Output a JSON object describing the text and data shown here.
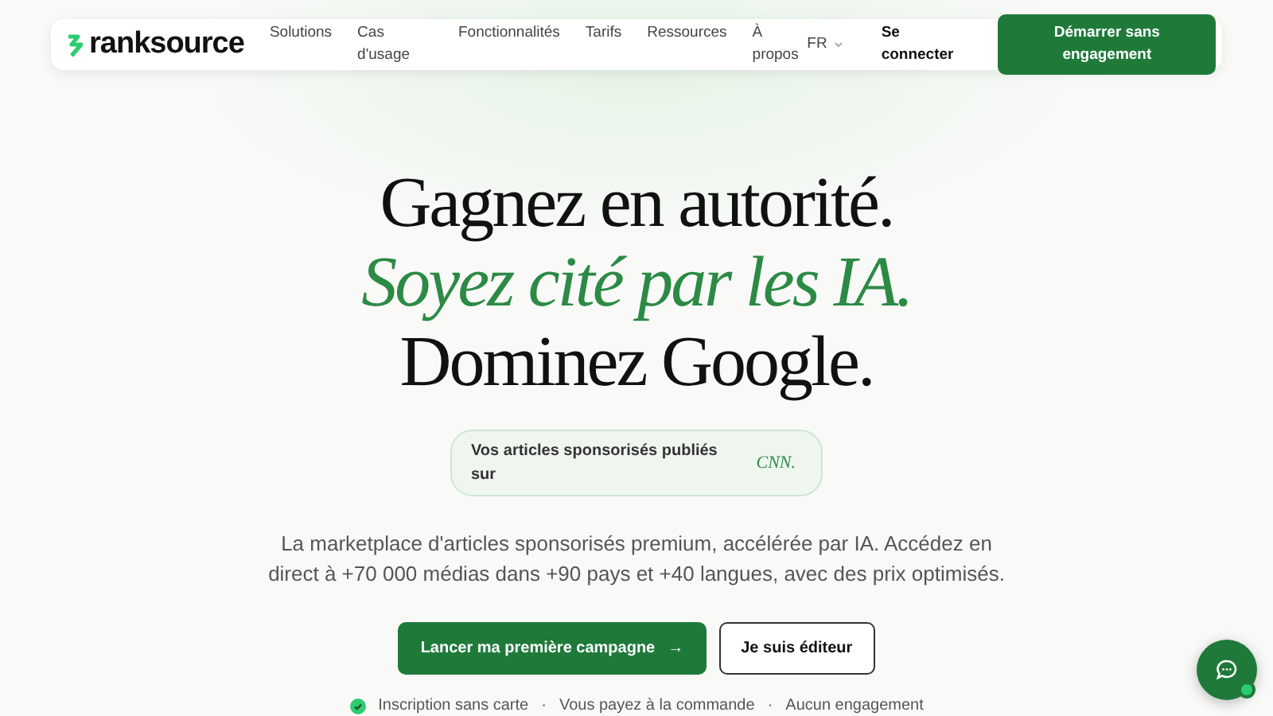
{
  "nav": {
    "logo": "ranksource",
    "links": [
      "Solutions",
      "Cas d'usage",
      "Fonctionnalités",
      "Tarifs",
      "Ressources",
      "À propos"
    ],
    "language": "FR",
    "login": "Se connecter",
    "cta": "Démarrer sans engagement"
  },
  "hero": {
    "headline": [
      {
        "text": "Gagnez en autorité.",
        "kind": "plain"
      },
      {
        "text": "Soyez cité par les IA.",
        "kind": "accent"
      },
      {
        "text": "Dominez Google.",
        "kind": "plain"
      }
    ],
    "pill": {
      "text": "Vos articles sponsorisés publiés sur",
      "media": "CNN."
    },
    "description": "La marketplace d'articles sponsorisés premium, accélérée par IA. Accédez en direct à +70 000 médias dans +90 pays et +40 langues, avec des prix optimisés.",
    "primary_button": {
      "label": "Lancer ma première campagne",
      "icon": "→"
    },
    "secondary_button": "Je suis éditeur",
    "perks": [
      "Inscription sans carte",
      "Vous payez à la commande",
      "Aucun engagement"
    ],
    "separator": "·"
  }
}
